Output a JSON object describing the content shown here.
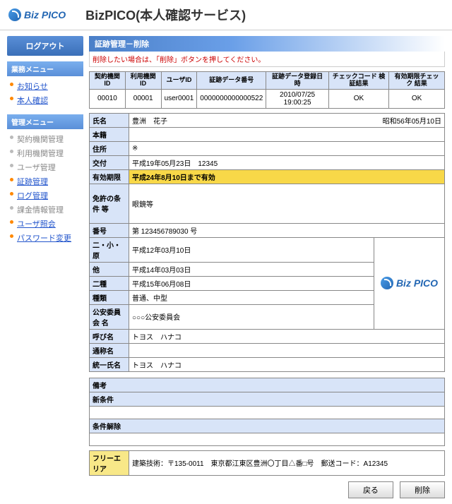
{
  "app": {
    "logo_text": "Biz PICO",
    "title": "BizPICO(本人確認サービス)"
  },
  "sidebar": {
    "logout": "ログアウト",
    "biz_header": "業務メニュー",
    "biz_items": [
      {
        "label": "お知らせ",
        "link": true
      },
      {
        "label": "本人確認",
        "link": true
      }
    ],
    "mgmt_header": "管理メニュー",
    "mgmt_items": [
      {
        "label": "契約機関管理",
        "link": false
      },
      {
        "label": "利用機関管理",
        "link": false
      },
      {
        "label": "ユーザ管理",
        "link": false
      },
      {
        "label": "証跡管理",
        "link": true
      },
      {
        "label": "ログ管理",
        "link": true
      },
      {
        "label": "課金情報管理",
        "link": false
      },
      {
        "label": "ユーザ照会",
        "link": true
      },
      {
        "label": "パスワード変更",
        "link": true
      }
    ]
  },
  "section": {
    "title": "証跡管理－削除",
    "instruction": "削除したい場合は、「削除」ボタンを押してください。"
  },
  "top": {
    "headers": {
      "c1": "契約機関\nID",
      "c2": "利用機関\nID",
      "c3": "ユーザID",
      "c4": "証跡データ番号",
      "c5": "証跡データ登録日時",
      "c6": "チェックコード\n検証結果",
      "c7": "有効期限チェック\n結果"
    },
    "row": {
      "c1": "00010",
      "c2": "00001",
      "c3": "user0001",
      "c4": "0000000000000522",
      "c5": "2010/07/25 19:00:25",
      "c6": "OK",
      "c7": "OK"
    }
  },
  "detail": {
    "name_label": "氏名",
    "name_value": "豊洲　花子",
    "dob": "昭和56年05月10日",
    "honseki_label": "本籍",
    "honseki_value": "",
    "addr_label": "住所",
    "addr_value": "※",
    "issue_label": "交付",
    "issue_value": "平成19年05月23日　12345",
    "valid_label": "有効期限",
    "valid_value": "平成24年8月10日まで有効",
    "cond_label": "免許の条件\n等",
    "cond_value": "眼鏡等",
    "num_label": "番号",
    "num_value": "第 123456789030 号",
    "nishoge_label": "二・小・原",
    "nishoge_value": "平成12年03月10日",
    "ta_label": "他",
    "ta_value": "平成14年03月03日",
    "nishu_label": "二種",
    "nishu_value": "平成15年06月08日",
    "shurui_label": "種類",
    "shurui_value": "普通、中型",
    "psc_label": "公安委員会\n名",
    "psc_value": "○○○公安委員会",
    "yobi_label": "呼び名",
    "yobi_value": "トヨス　ハナコ",
    "tsusho_label": "通称名",
    "tsusho_value": "",
    "touitsu_label": "統一氏名",
    "touitsu_value": "トヨス　ハナコ",
    "logo_text": "Biz PICO"
  },
  "memo": {
    "biko_label": "備考",
    "shin_label": "新条件",
    "kaijo_label": "条件解除"
  },
  "free": {
    "label": "フリーエリア",
    "value": "建築技術：〒135-0011　東京都江東区豊洲〇丁目△番□号　郵送コード：A12345"
  },
  "buttons": {
    "back": "戻る",
    "delete": "削除"
  }
}
